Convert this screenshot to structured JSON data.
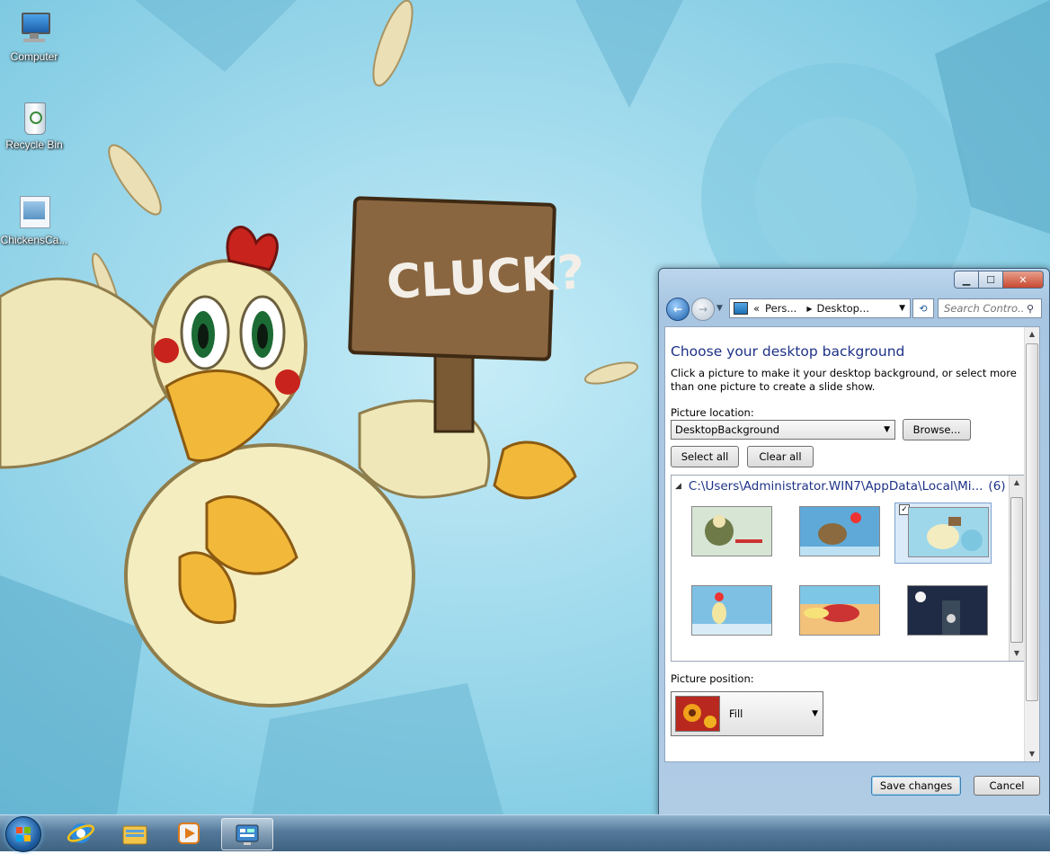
{
  "desktop": {
    "wallpaper_sign_text": "CLUCK?",
    "icons": [
      {
        "label": "Computer",
        "icon": "computer-icon"
      },
      {
        "label": "Recycle Bin",
        "icon": "recycle-bin-icon"
      },
      {
        "label": "ChickensCa...",
        "icon": "document-icon"
      }
    ]
  },
  "window": {
    "nav": {
      "address_prefix": "«",
      "address_segments": [
        "Pers...",
        "Desktop..."
      ],
      "search_placeholder": "Search Contro..."
    },
    "heading": "Choose your desktop background",
    "description": "Click a picture to make it your desktop background, or select more than one picture to create a slide show.",
    "picture_location_label": "Picture location:",
    "picture_location_value": "DesktopBackground",
    "browse_label": "Browse...",
    "select_all_label": "Select all",
    "clear_all_label": "Clear all",
    "folder_path": "C:\\Users\\Administrator.WIN7\\AppData\\Local\\Mi...",
    "folder_count": "(6)",
    "thumbnails": [
      {
        "name": "wallpaper-1",
        "selected": false
      },
      {
        "name": "wallpaper-2",
        "selected": false
      },
      {
        "name": "wallpaper-3",
        "selected": true
      },
      {
        "name": "wallpaper-4",
        "selected": false
      },
      {
        "name": "wallpaper-5",
        "selected": false
      },
      {
        "name": "wallpaper-6",
        "selected": false
      }
    ],
    "picture_position_label": "Picture position:",
    "picture_position_value": "Fill",
    "save_label": "Save changes",
    "cancel_label": "Cancel"
  },
  "taskbar": {
    "items": [
      "start-orb",
      "internet-explorer-icon",
      "windows-explorer-icon",
      "media-player-icon",
      "control-panel-icon"
    ],
    "active_item": "control-panel-icon"
  },
  "colors": {
    "heading": "#1e3287",
    "wallpaper": "#9ed9ec",
    "selection": "#dbeaf9"
  }
}
